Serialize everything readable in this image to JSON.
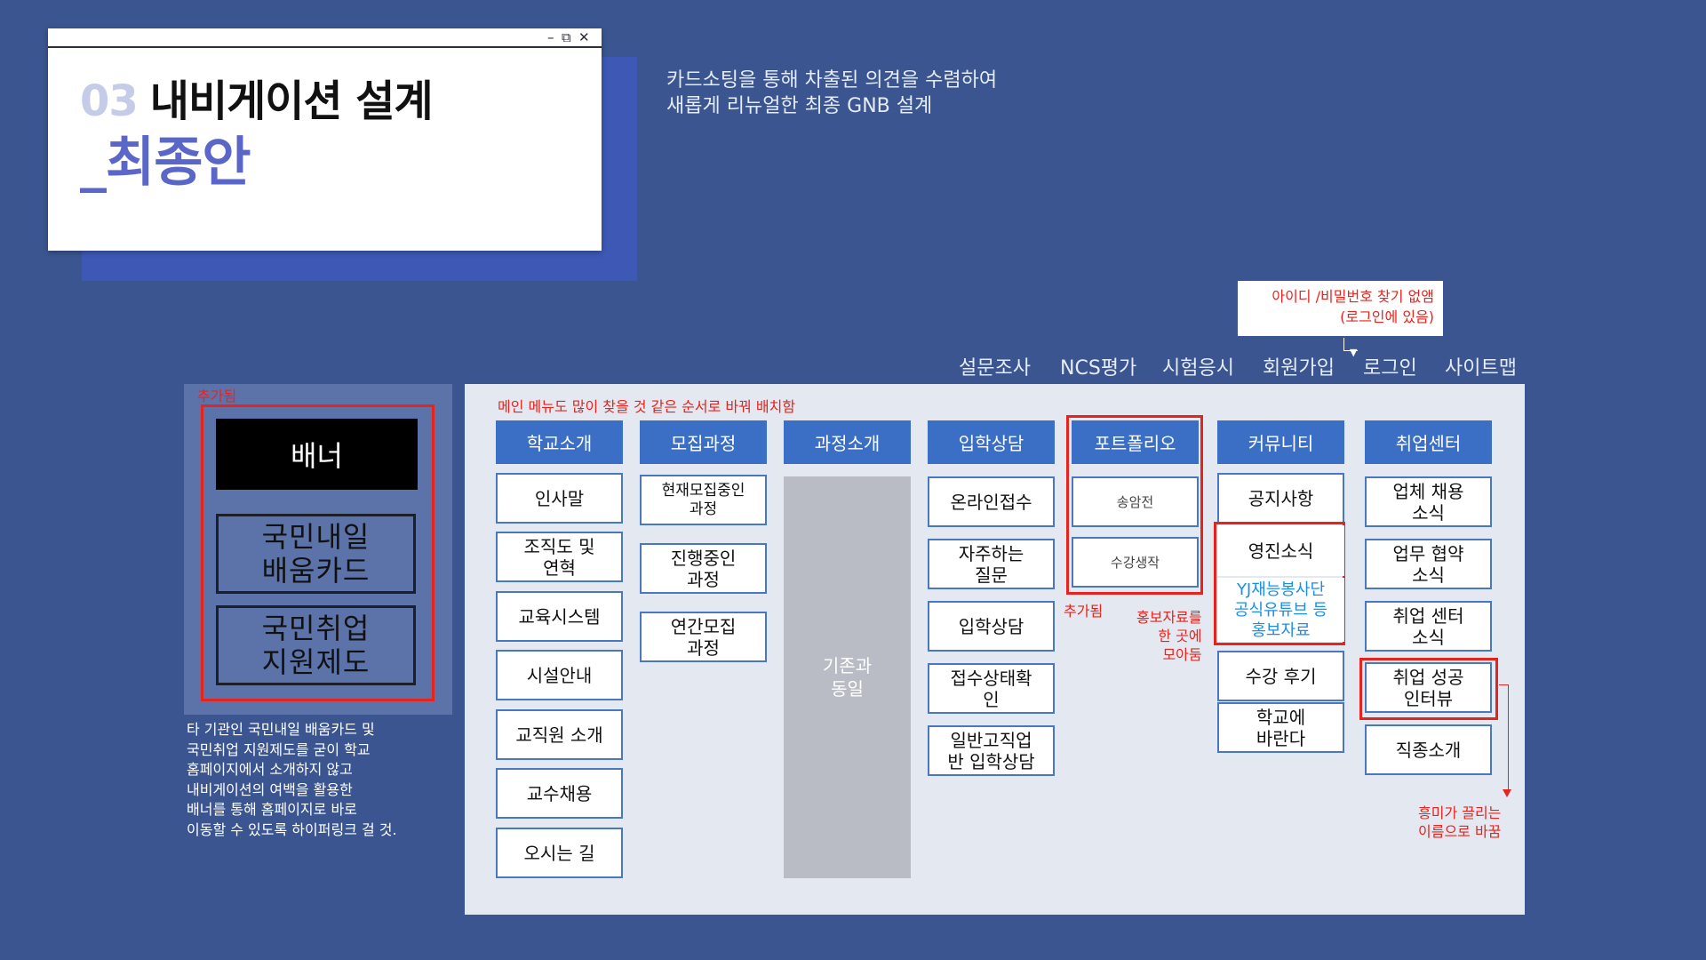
{
  "title": {
    "number": "03",
    "heading": "내비게이션 설계",
    "subheading": "_최종안"
  },
  "description": [
    "카드소팅을 통해 차출된 의견을 수렴하여",
    "새롭게 리뉴얼한 최종 GNB 설계"
  ],
  "tooltip": {
    "line1": "아이디 /비밀번호 찾기 없앰",
    "line2": "(로그인에 있음)"
  },
  "util_menu": [
    "설문조사",
    "NCS평가",
    "시험응시",
    "회원가입",
    "로그인",
    "사이트맵"
  ],
  "left_panel": {
    "added_label": "추가됨",
    "banner_label": "배너",
    "cards": [
      [
        "국민내일",
        "배움카드"
      ],
      [
        "국민취업",
        "지원제도"
      ]
    ],
    "note": [
      "타 기관인 국민내일 배움카드 및",
      "국민취업 지원제도를 굳이 학교",
      "홈페이지에서 소개하지 않고",
      "내비게이션의 여백을 활용한",
      "배너를 통해 홈페이지로 바로",
      "이동할 수 있도록 하이퍼링크 걸 것."
    ]
  },
  "main_panel": {
    "note": "메인 메뉴도 많이 찾을 것 같은 순서로 바꿔 배치함",
    "gnb": [
      "학교소개",
      "모집과정",
      "과정소개",
      "입학상담",
      "포트폴리오",
      "커뮤니티",
      "취업센터"
    ],
    "school_intro": [
      [
        "인사말"
      ],
      [
        "조직도 및",
        "연혁"
      ],
      [
        "교육시스템"
      ],
      [
        "시설안내"
      ],
      [
        "교직원 소개"
      ],
      [
        "교수채용"
      ],
      [
        "오시는 길"
      ]
    ],
    "recruit": [
      [
        "현재모집중인",
        "과정"
      ],
      [
        "진행중인",
        "과정"
      ],
      [
        "연간모집",
        "과정"
      ]
    ],
    "course_intro_note": [
      "기존과",
      "동일"
    ],
    "admission": [
      [
        "온라인접수"
      ],
      [
        "자주하는",
        "질문"
      ],
      [
        "입학상담"
      ],
      [
        "접수상태확",
        "인"
      ],
      [
        "일반고직업",
        "반 입학상담"
      ]
    ],
    "portfolio": [
      [
        "송암전"
      ],
      [
        "수강생작"
      ]
    ],
    "portfolio_added": "추가됨",
    "community": {
      "notice": "공지사항",
      "news": "영진소식",
      "promo": [
        "YJ재능봉사단",
        "공식유튜브 등",
        "홍보자료"
      ],
      "review": "수강 후기",
      "suggest": [
        "학교에",
        "바란다"
      ]
    },
    "promo_note": [
      "홍보자료를",
      "한 곳에",
      "모아둠"
    ],
    "career": [
      [
        "업체 채용",
        "소식"
      ],
      [
        "업무 협약",
        "소식"
      ],
      [
        "취업 센터",
        "소식"
      ],
      [
        "취업 성공",
        "인터뷰"
      ],
      [
        "직종소개"
      ]
    ],
    "rename_note": [
      "흥미가 끌리는",
      "이름으로 바꿈"
    ]
  },
  "colors": {
    "background": "#3b5591",
    "gnb_blue": "#3b6fc5",
    "highlight_red": "#e8231e",
    "promo_blue": "#1a8fe6"
  }
}
